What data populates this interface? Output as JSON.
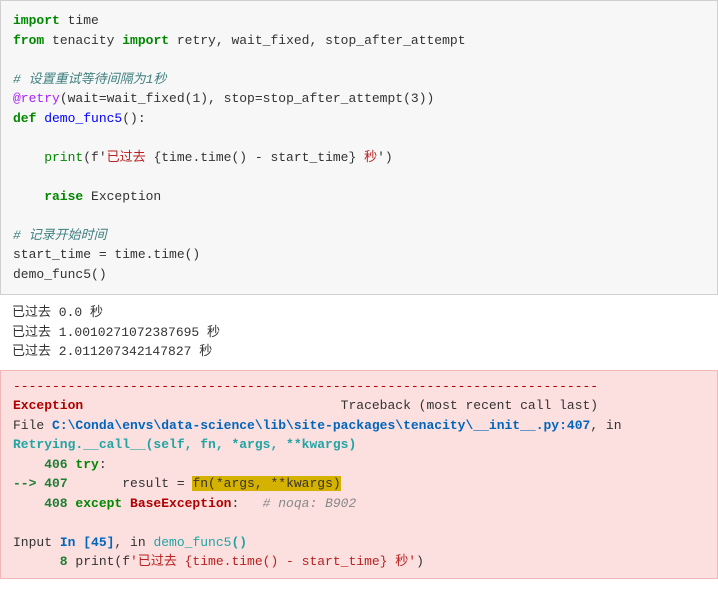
{
  "code": {
    "l1_import": "import",
    "l1_time": " time",
    "l2_from": "from",
    "l2_tenacity": " tenacity ",
    "l2_import": "import",
    "l2_rest": " retry, wait_fixed, stop_after_attempt",
    "l4_comment": "# 设置重试等待间隔为1秒",
    "l5_decorator": "@retry",
    "l5_args": "(wait=wait_fixed(",
    "l5_num1": "1",
    "l5_mid": "), stop=stop_after_attempt(",
    "l5_num2": "3",
    "l5_end": "))",
    "l6_def": "def",
    "l6_name": " demo_func5",
    "l6_paren": "():",
    "l8_print": "    print",
    "l8_str_open": "(f'",
    "l8_str1": "已过去 ",
    "l8_expr_open": "{time.time() - start_time}",
    "l8_str2": " 秒",
    "l8_str_close": "')",
    "l10_raise": "    raise",
    "l10_exc": " Exception",
    "l12_comment": "# 记录开始时间",
    "l13": "start_time = time.time()",
    "l14": "demo_func5()"
  },
  "output": {
    "l1": "已过去 0.0 秒",
    "l2": "已过去 1.0010271072387695 秒",
    "l3": "已过去 2.011207342147827 秒"
  },
  "error": {
    "dashes": "---------------------------------------------------------------------------",
    "exc_name": "Exception",
    "traceback": "                                 Traceback (most recent call last)",
    "file_pre": "File ",
    "file_path": "C:\\Conda\\envs\\data-science\\lib\\site-packages\\tenacity\\__init__.py:407",
    "file_post": ", in ",
    "retry_call": "Retrying.__call__",
    "retry_args": "(self, fn, *args, **kwargs)",
    "ln406": "    406",
    "try_kw": " try",
    "try_colon": ":",
    "arrow": "--> ",
    "ln407": "407",
    "result_pre": "       result = ",
    "fn_call": "fn(*args, **kwargs)",
    "ln408": "    408",
    "except_kw": " except",
    "base_exc": " BaseException",
    "colon": ":",
    "noqa": "   # noqa: B902",
    "input_pre": "Input ",
    "input_in": "In [45]",
    "input_post": ", in ",
    "demo_func": "demo_func5",
    "demo_paren": "()",
    "ln8": "      8",
    "print_kw": " print",
    "print_open": "(f",
    "print_str": "'已过去 {time.time() - start_time} 秒'",
    "print_close": ")"
  }
}
